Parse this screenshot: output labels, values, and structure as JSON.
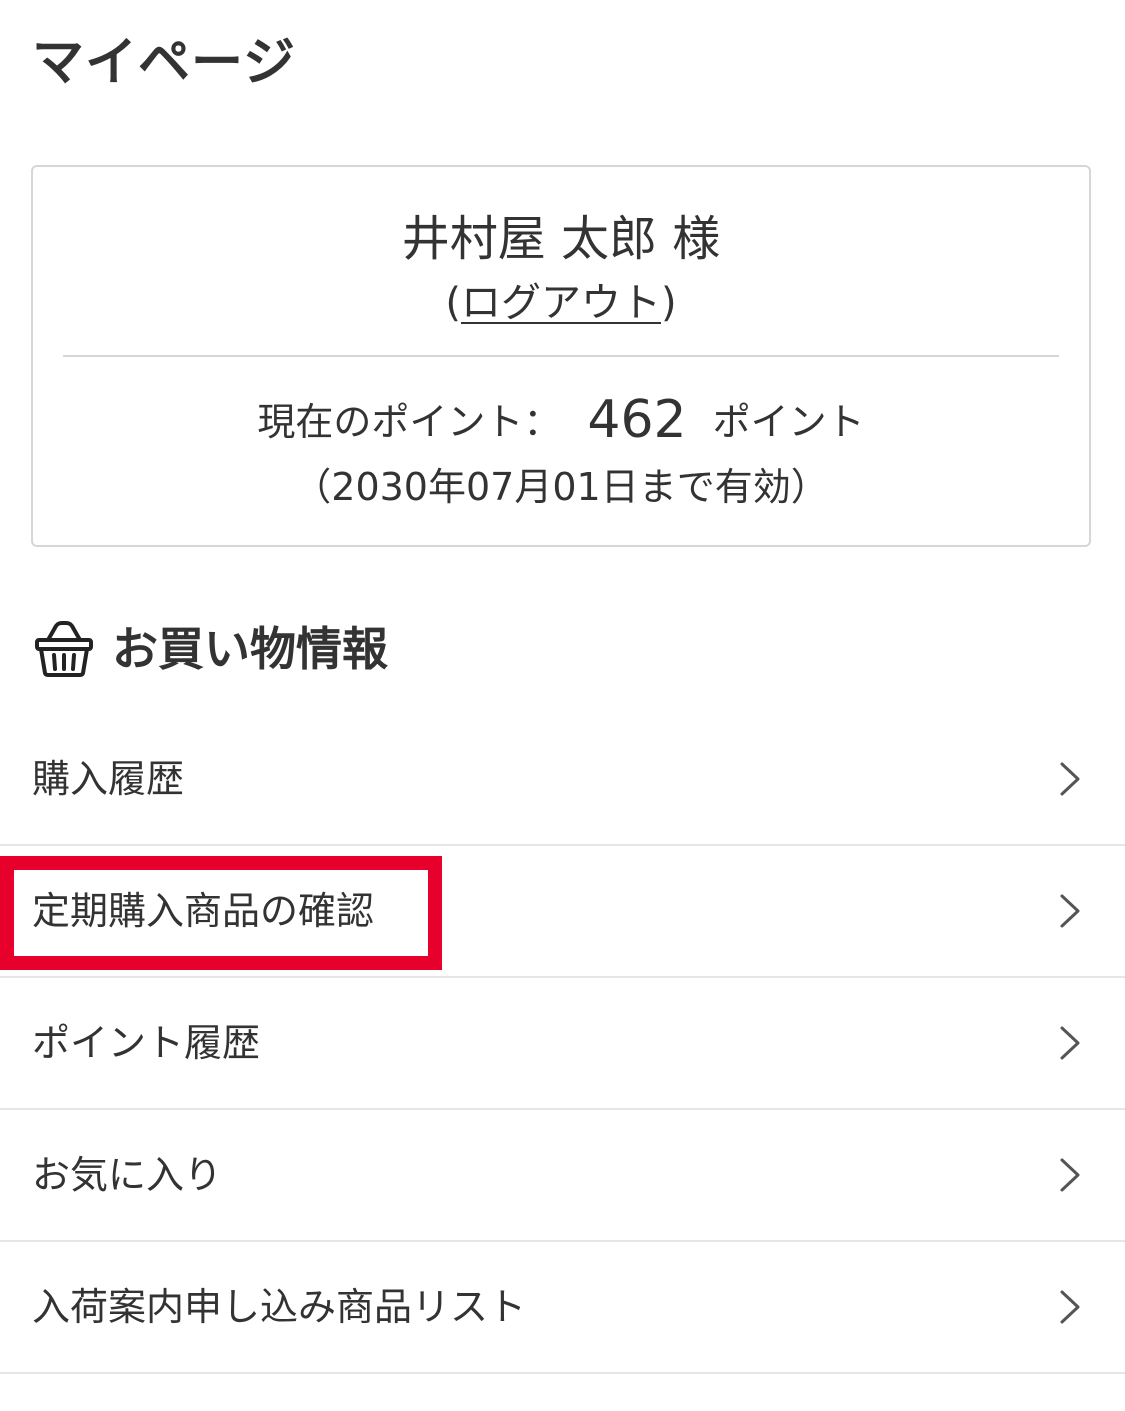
{
  "header": {
    "title": "マイページ"
  },
  "user_card": {
    "name": "井村屋 太郎 様",
    "logout_open": "(",
    "logout_label": "ログアウト",
    "logout_close": ")",
    "points_label": "現在のポイント：",
    "points_value": "462",
    "points_unit": "ポイント",
    "validity": "（2030年07月01日まで有効）"
  },
  "shopping_section": {
    "icon": "basket-icon",
    "title": "お買い物情報",
    "items": [
      {
        "label": "購入履歴",
        "icon": "chevron-right-icon"
      },
      {
        "label": "定期購入商品の確認",
        "icon": "chevron-right-icon",
        "highlighted": true
      },
      {
        "label": "ポイント履歴",
        "icon": "chevron-right-icon"
      },
      {
        "label": "お気に入り",
        "icon": "chevron-right-icon"
      },
      {
        "label": "入荷案内申し込み商品リスト",
        "icon": "chevron-right-icon"
      }
    ]
  },
  "colors": {
    "text": "#333333",
    "border": "#d6d6d6",
    "divider": "#e6e6e6",
    "highlight": "#e8002d"
  }
}
